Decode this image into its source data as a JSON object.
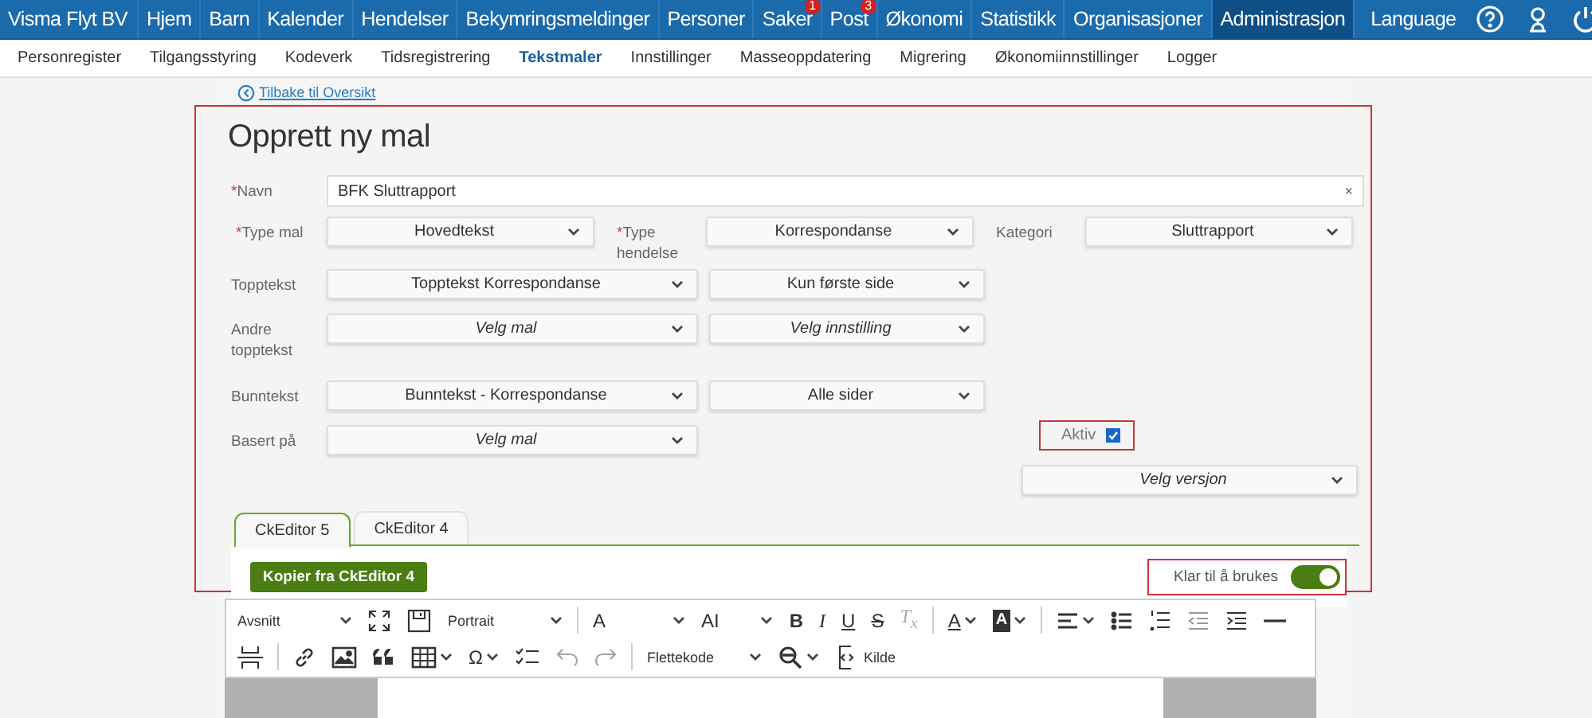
{
  "top_nav": {
    "brand": "Visma Flyt BV",
    "items": [
      {
        "label": "Hjem",
        "selected": false
      },
      {
        "label": "Barn",
        "selected": false
      },
      {
        "label": "Kalender",
        "selected": false
      },
      {
        "label": "Hendelser",
        "selected": false
      },
      {
        "label": "Bekymringsmeldinger",
        "selected": false
      },
      {
        "label": "Personer",
        "selected": false
      },
      {
        "label": "Saker",
        "selected": false,
        "badge": "1"
      },
      {
        "label": "Post",
        "selected": false,
        "badge": "3"
      },
      {
        "label": "Økonomi",
        "selected": false
      },
      {
        "label": "Statistikk",
        "selected": false
      },
      {
        "label": "Organisasjoner",
        "selected": false
      },
      {
        "label": "Administrasjon",
        "selected": true
      }
    ],
    "language": "Language"
  },
  "sub_nav": [
    {
      "label": "Personregister",
      "selected": false
    },
    {
      "label": "Tilgangsstyring",
      "selected": false
    },
    {
      "label": "Kodeverk",
      "selected": false
    },
    {
      "label": "Tidsregistrering",
      "selected": false
    },
    {
      "label": "Tekstmaler",
      "selected": true
    },
    {
      "label": "Innstillinger",
      "selected": false
    },
    {
      "label": "Masseoppdatering",
      "selected": false
    },
    {
      "label": "Migrering",
      "selected": false
    },
    {
      "label": "Økonomiinnstillinger",
      "selected": false
    },
    {
      "label": "Logger",
      "selected": false
    }
  ],
  "back_link": "Tilbake til Oversikt",
  "form": {
    "title": "Opprett ny mal",
    "name": {
      "label": "Navn",
      "required_mark": "*",
      "value": "BFK Sluttrapport",
      "clear": "×"
    },
    "type_row": [
      {
        "label": "Type mal",
        "required_mark": "*",
        "value": "Hovedtekst",
        "placeholder": false
      },
      {
        "label": "Type hendelse",
        "required_mark": "*",
        "value": "Korrespondanse",
        "placeholder": false
      },
      {
        "label": "Kategori",
        "value": "Sluttrapport",
        "placeholder": false
      }
    ],
    "rows": [
      {
        "label": "Topptekst",
        "selects": [
          {
            "value": "Topptekst Korrespondanse",
            "placeholder": false
          },
          {
            "value": "Kun første side",
            "placeholder": false
          }
        ]
      },
      {
        "label": "Andre topptekst",
        "selects": [
          {
            "value": "Velg mal",
            "placeholder": true
          },
          {
            "value": "Velg innstilling",
            "placeholder": true
          }
        ]
      },
      {
        "label": "Bunntekst",
        "selects": [
          {
            "value": "Bunntekst - Korrespondanse",
            "placeholder": false
          },
          {
            "value": "Alle sider",
            "placeholder": false
          }
        ]
      },
      {
        "label": "Basert på",
        "selects": [
          {
            "value": "Velg mal",
            "placeholder": true
          }
        ]
      }
    ],
    "active": {
      "label": "Aktiv",
      "checked": true
    },
    "version": {
      "value": "Velg versjon",
      "placeholder": true
    }
  },
  "editor_tabs": [
    {
      "label": "CkEditor 5",
      "selected": true
    },
    {
      "label": "CkEditor 4",
      "selected": false
    }
  ],
  "copy_button": "Kopier fra CkEditor 4",
  "ready_toggle": {
    "label": "Klar til å brukes",
    "on": true
  },
  "toolbar": [
    [
      {
        "kind": "dropdown",
        "label": "Avsnitt"
      },
      {
        "kind": "fullscreen"
      },
      {
        "kind": "pagesetup"
      },
      {
        "kind": "dropdown",
        "label": "Portrait"
      },
      {
        "kind": "separator"
      },
      {
        "kind": "fontsize",
        "text": "A"
      },
      {
        "kind": "fontfamily",
        "text": "AI"
      },
      {
        "kind": "bold",
        "text": "B"
      },
      {
        "kind": "italic",
        "text": "I"
      },
      {
        "kind": "underline",
        "text": "U"
      },
      {
        "kind": "strike",
        "text": "S"
      },
      {
        "kind": "clearformat",
        "text": "T$_{x}$"
      },
      {
        "kind": "separator"
      },
      {
        "kind": "fontcolor",
        "text": "A"
      },
      {
        "kind": "highlight",
        "text": "A"
      },
      {
        "kind": "separator"
      },
      {
        "kind": "align"
      },
      {
        "kind": "bullets"
      },
      {
        "kind": "numbers"
      },
      {
        "kind": "outdent"
      },
      {
        "kind": "indent"
      },
      {
        "kind": "rule"
      }
    ],
    [
      {
        "kind": "pagebreak"
      },
      {
        "kind": "separator"
      },
      {
        "kind": "link"
      },
      {
        "kind": "image"
      },
      {
        "kind": "quote"
      },
      {
        "kind": "table"
      },
      {
        "kind": "specialchars",
        "text": "Ω"
      },
      {
        "kind": "todo"
      },
      {
        "kind": "undo"
      },
      {
        "kind": "redo"
      },
      {
        "kind": "separator"
      },
      {
        "kind": "dropdown",
        "label": "Flettekode"
      },
      {
        "kind": "find"
      },
      {
        "kind": "source",
        "label": "Kilde"
      }
    ]
  ]
}
